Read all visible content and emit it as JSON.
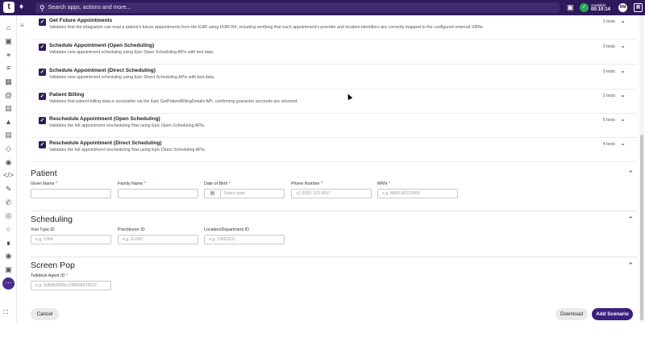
{
  "topbar": {
    "logo": "t",
    "search_placeholder": "Search apps, actions and more...",
    "status_label": "Available",
    "status_timer": "00:10:14",
    "avatar_initials": "RM"
  },
  "tests": [
    {
      "title": "Get Future Appointments",
      "desc": "Validates that the integration can read a patient's future appointments from the EHR using FHIR R4, including verifying that each appointment's provider and location identifiers are correctly mapped to the configured external URNs.",
      "count": "2 tests"
    },
    {
      "title": "Schedule Appointment (Open Scheduling)",
      "desc": "Validates new appointment scheduling using Epic Open Scheduling APIs with test data.",
      "count": "3 tests"
    },
    {
      "title": "Schedule Appointment (Direct Scheduling)",
      "desc": "Validates new appointment scheduling using Epic Direct Scheduling APIs with test data.",
      "count": "3 tests"
    },
    {
      "title": "Patient Billing",
      "desc": "Validates that patient billing data is accessible via the Epic GetPatientBillingDetails API, confirming guarantor accounts are returned.",
      "count": "2 tests"
    },
    {
      "title": "Reschedule Appointment (Open Scheduling)",
      "desc": "Validates the full appointment rescheduling flow using Epic Open Scheduling APIs.",
      "count": "5 tests"
    },
    {
      "title": "Reschedule Appointment (Direct Scheduling)",
      "desc": "Validates the full appointment rescheduling flow using Epic Direct Scheduling APIs.",
      "count": "4 tests"
    }
  ],
  "patient": {
    "title": "Patient",
    "given_name": {
      "label": "Given Name",
      "value": ""
    },
    "family_name": {
      "label": "Family Name",
      "value": ""
    },
    "dob": {
      "label": "Date of Birth",
      "placeholder": "Select date"
    },
    "phone": {
      "label": "Phone Number",
      "placeholder": "+1 (555) 123-4567"
    },
    "mrn": {
      "label": "MRN",
      "placeholder": "e.g. MRN-00123456"
    }
  },
  "scheduling": {
    "title": "Scheduling",
    "visit_type": {
      "label": "Visit Type ID",
      "placeholder": "e.g. 1004"
    },
    "practitioner": {
      "label": "Practitioner ID",
      "placeholder": "e.g. E1000"
    },
    "location": {
      "label": "Location/Department ID",
      "placeholder": "e.g. 10501101"
    }
  },
  "screen_pop": {
    "title": "Screen Pop",
    "agent": {
      "label": "Talkdesk Agent ID",
      "placeholder": "e.g. 5d8db0583cc2484b8529022"
    }
  },
  "footer": {
    "cancel": "Cancel",
    "download": "Download",
    "add": "Add Scenario"
  },
  "required_mark": "*",
  "colors": {
    "brand": "#2e1a5a",
    "primary_button": "#3b1f7e",
    "available": "#27a95a"
  }
}
